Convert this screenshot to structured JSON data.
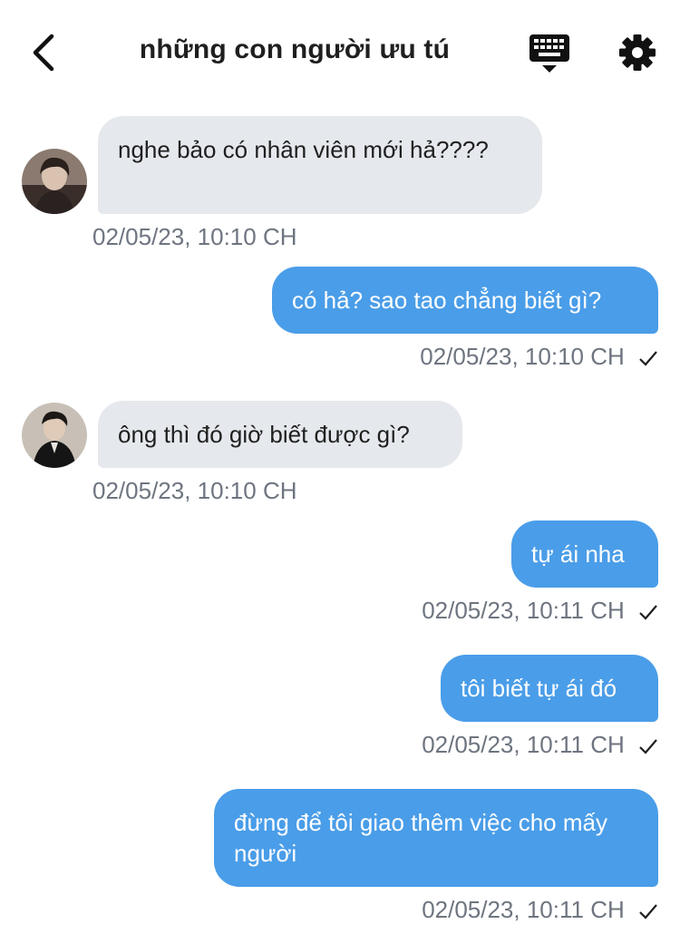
{
  "header": {
    "title": "những con người ưu tú",
    "back_icon": "chevron-left-icon",
    "keyboard_icon": "keyboard-icon",
    "settings_icon": "gear-icon"
  },
  "colors": {
    "incoming_bubble": "#e5e8ec",
    "outgoing_bubble": "#4a9de8",
    "timestamp": "#6e7580"
  },
  "messages": [
    {
      "direction": "incoming",
      "text": "nghe bảo có nhân viên mới hả????",
      "time": "02/05/23, 10:10 CH"
    },
    {
      "direction": "outgoing",
      "text": "có hả? sao tao chẳng biết gì?",
      "time": "02/05/23, 10:10 CH",
      "status_icon": "check-icon"
    },
    {
      "direction": "incoming",
      "text": "ông thì đó giờ biết được gì?",
      "time": "02/05/23, 10:10 CH"
    },
    {
      "direction": "outgoing",
      "text": "tự ái nha",
      "time": "02/05/23, 10:11 CH",
      "status_icon": "check-icon"
    },
    {
      "direction": "outgoing",
      "text": "tôi biết tự ái đó",
      "time": "02/05/23, 10:11 CH",
      "status_icon": "check-icon"
    },
    {
      "direction": "outgoing",
      "text": "đừng để tôi giao thêm việc cho mấy người",
      "time": "02/05/23, 10:11 CH",
      "status_icon": "check-icon"
    }
  ]
}
